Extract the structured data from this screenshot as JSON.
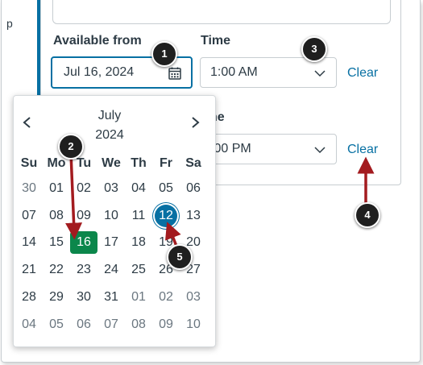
{
  "left_strip_text": "p",
  "available_from": {
    "label": "Available from",
    "date_value": "Jul 16, 2024",
    "time_label": "Time",
    "time_value": "1:00 AM",
    "clear_label": "Clear"
  },
  "until": {
    "time_label_partial": "ne",
    "time_value_partial": ":00 PM",
    "clear_label": "Clear"
  },
  "calendar": {
    "month": "July",
    "year": "2024",
    "weekdays": [
      "Su",
      "Mo",
      "Tu",
      "We",
      "Th",
      "Fr",
      "Sa"
    ],
    "weeks": [
      [
        "30",
        "01",
        "02",
        "03",
        "04",
        "05",
        "06"
      ],
      [
        "07",
        "08",
        "09",
        "10",
        "11",
        "12",
        "13"
      ],
      [
        "14",
        "15",
        "16",
        "17",
        "18",
        "19",
        "20"
      ],
      [
        "21",
        "22",
        "23",
        "24",
        "25",
        "26",
        "27"
      ],
      [
        "28",
        "29",
        "30",
        "31",
        "01",
        "02",
        "03"
      ],
      [
        "04",
        "05",
        "06",
        "07",
        "08",
        "09",
        "10"
      ]
    ],
    "today": "16",
    "selected": "12"
  },
  "annotations": [
    "1",
    "2",
    "3",
    "4",
    "5"
  ],
  "colors": {
    "accent": "#0770a3",
    "today": "#0b874b",
    "arrow": "#a31b1f",
    "badge": "#1f1f1f"
  }
}
